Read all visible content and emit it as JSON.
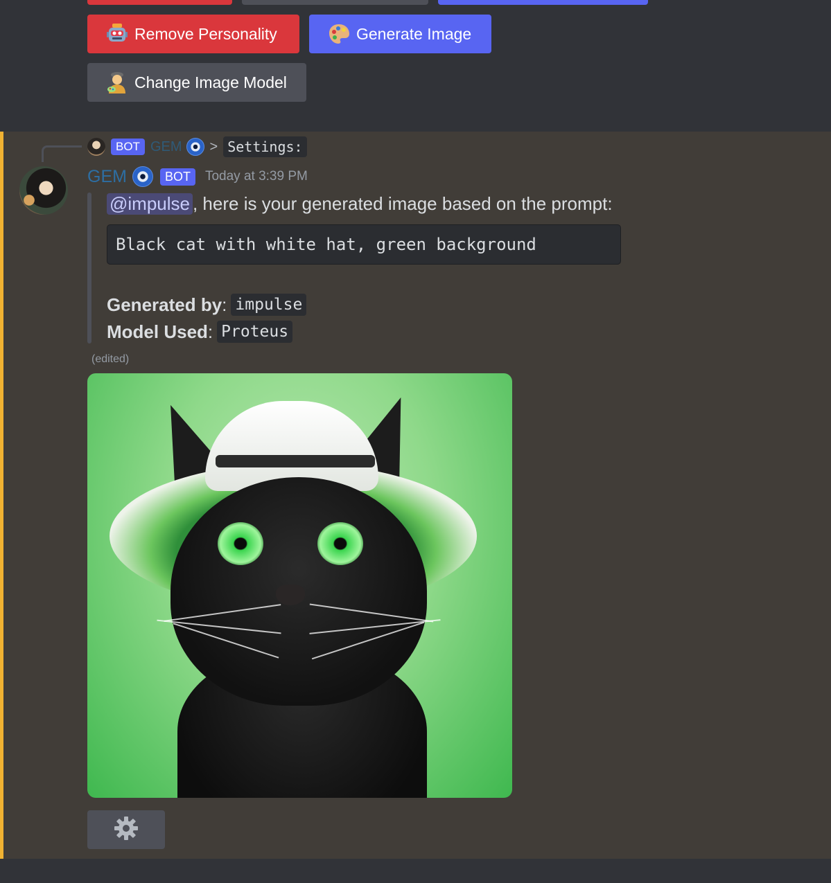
{
  "buttons": {
    "remove_personality": "Remove Personality",
    "generate_image": "Generate Image",
    "change_image_model": "Change Image Model"
  },
  "reply": {
    "badge": "BOT",
    "author": "GEM",
    "arrow": ">",
    "content": "Settings:"
  },
  "message": {
    "author": "GEM",
    "badge": "BOT",
    "timestamp": "Today at 3:39 PM",
    "mention": "@impulse",
    "intro": ", here is your generated image based on the prompt:",
    "prompt": "Black cat with white hat, green background",
    "generated_by_label": "Generated by",
    "generated_by_value": "impulse",
    "model_label": "Model Used",
    "model_value": "Proteus",
    "separator": ":",
    "edited": "(edited)"
  },
  "colors": {
    "accent_blue": "#5865f2",
    "danger_red": "#da373c",
    "secondary_gray": "#4e5058",
    "highlight_bar": "#f0b232"
  },
  "icons": {
    "remove_personality": "robot-icon",
    "generate_image": "palette-icon",
    "change_image_model": "artist-icon",
    "settings": "gear-icon",
    "author_emoji": "nazar-eye-icon"
  }
}
